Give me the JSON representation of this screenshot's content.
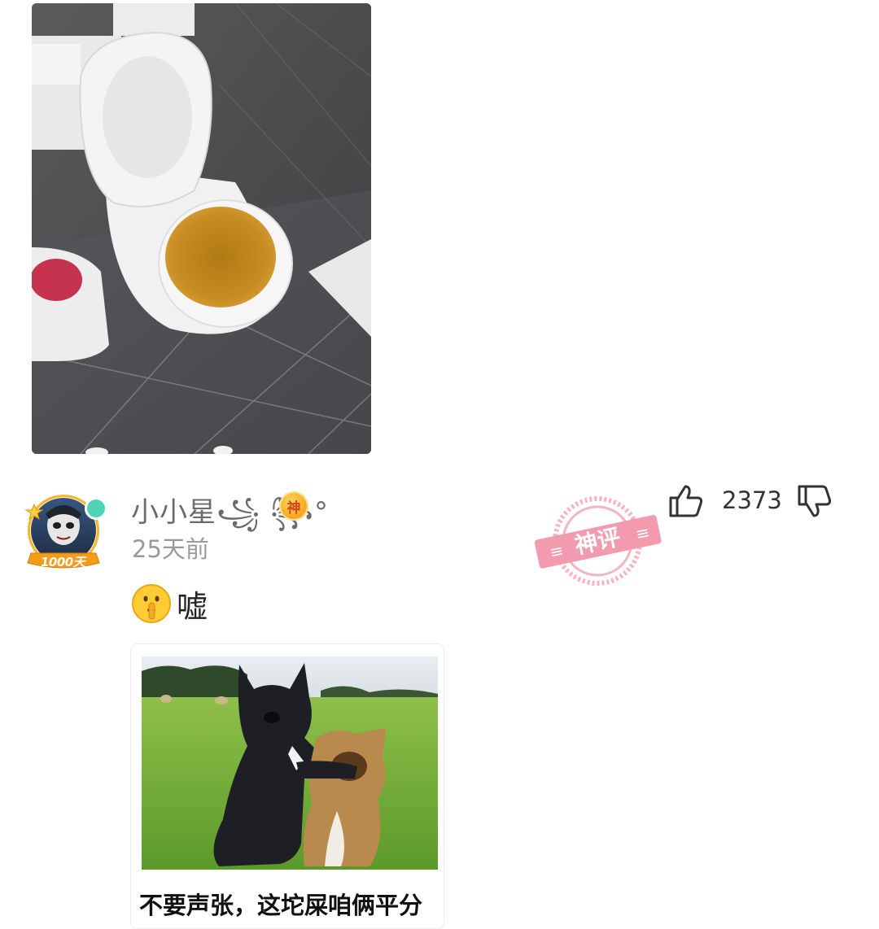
{
  "post": {
    "image_alt": "toilet-photo"
  },
  "comment": {
    "username": "小小星꧁ ꧂°",
    "badge_label": "神",
    "avatar_badge": "1000天",
    "timestamp": "25天前",
    "text": "嘘",
    "emoji": "shushing-face",
    "like_count": "2373",
    "stamp_text": "神评",
    "meme": {
      "caption": "不要声张，这坨屎咱俩平分"
    }
  },
  "colors": {
    "online": "#4fd3b6",
    "badge": "#f7a21c",
    "stamp": "#f08aa0"
  }
}
